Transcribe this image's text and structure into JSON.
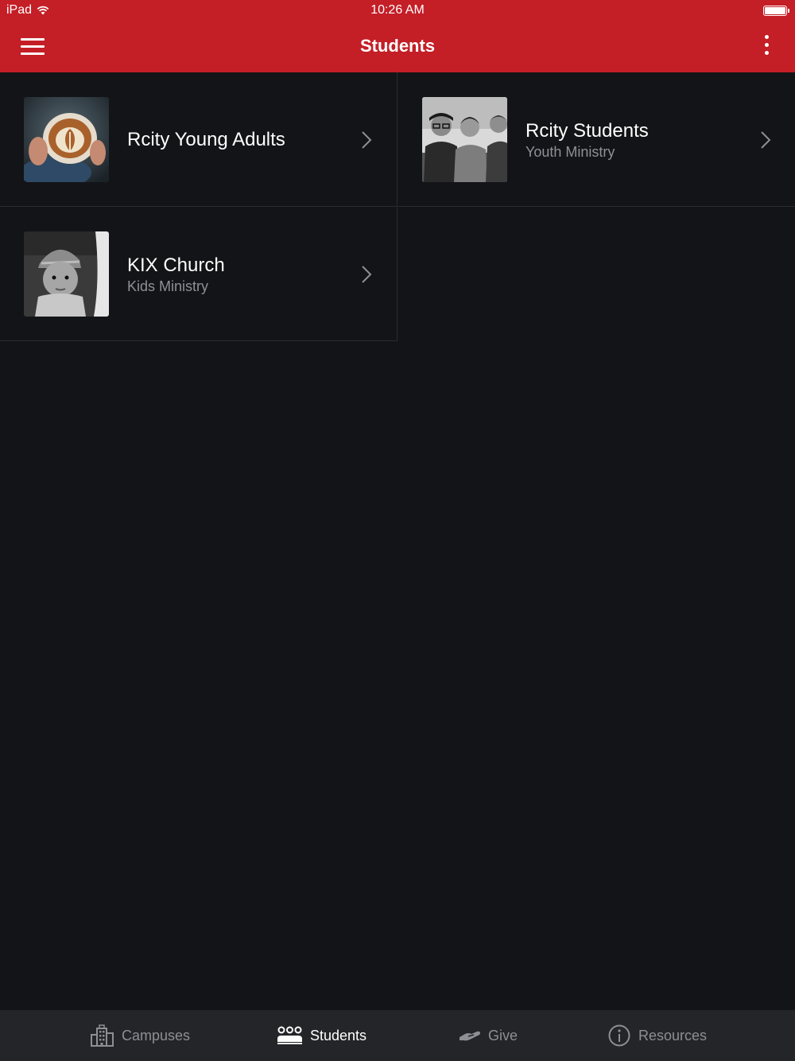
{
  "status_bar": {
    "device": "iPad",
    "time": "10:26 AM"
  },
  "nav": {
    "title": "Students"
  },
  "groups": [
    {
      "title": "Rcity Young Adults",
      "subtitle": ""
    },
    {
      "title": "Rcity Students",
      "subtitle": "Youth Ministry"
    },
    {
      "title": "KIX Church",
      "subtitle": "Kids Ministry"
    }
  ],
  "tabs": [
    {
      "label": "Campuses",
      "icon": "building-icon",
      "active": false
    },
    {
      "label": "Students",
      "icon": "group-icon",
      "active": true
    },
    {
      "label": "Give",
      "icon": "giving-hand-icon",
      "active": false
    },
    {
      "label": "Resources",
      "icon": "info-icon",
      "active": false
    }
  ],
  "colors": {
    "brand_red": "#c41e26",
    "background": "#131417",
    "tab_bar": "#242528",
    "inactive_text": "#8e8f94"
  }
}
